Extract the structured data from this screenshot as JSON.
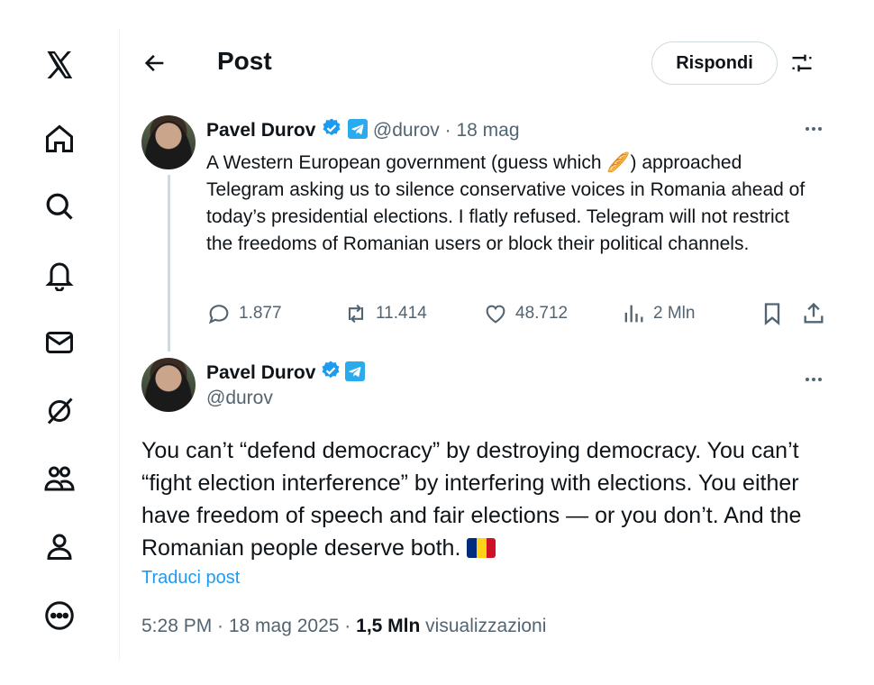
{
  "header": {
    "title": "Post",
    "reply_button": "Rispondi"
  },
  "nav": [
    "x-logo",
    "home",
    "explore",
    "notifications",
    "messages",
    "grok",
    "communities",
    "profile",
    "more"
  ],
  "parent_post": {
    "author": "Pavel Durov",
    "handle": "@durov",
    "separator": "·",
    "date": "18 mag",
    "text_before_emoji": "A Western European government (guess which ",
    "emoji": "🥖",
    "text_after_emoji": ") approached Telegram asking us to silence conservative voices in Romania ahead of today’s presidential elections. I flatly refused. Telegram will not restrict the freedoms of Romanian users or block their political channels.",
    "replies": "1.877",
    "reposts": "11.414",
    "likes": "48.712",
    "views": "2 Mln"
  },
  "main_post": {
    "author": "Pavel Durov",
    "handle": "@durov",
    "text": "You can’t “defend democracy” by destroying democracy. You can’t “fight election interference” by interfering with elections. You either have freedom of speech and fair elections — or you don’t. And the Romanian people deserve both.",
    "translate": "Traduci post",
    "time_date": "5:28 PM · 18 mag 2025 ·",
    "views_count": "1,5 Mln",
    "views_label": "visualizzazioni"
  },
  "colors": {
    "accent": "#1d9bf0",
    "muted": "#536471",
    "telegram": "#2aabee"
  }
}
